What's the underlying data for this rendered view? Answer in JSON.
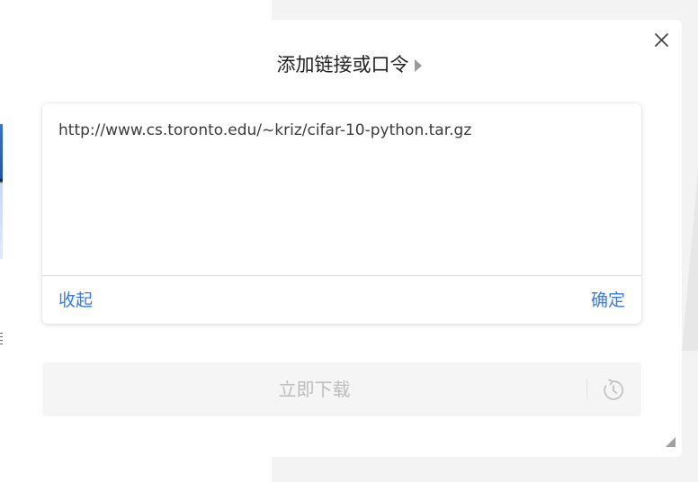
{
  "dialog": {
    "title": "添加链接或口令",
    "title_arrow_icon": "triangle-right-icon",
    "close_icon": "close-icon"
  },
  "link_input": {
    "value": "http://www.cs.toronto.edu/~kriz/cifar-10-python.tar.gz",
    "collapse_label": "收起",
    "confirm_label": "确定"
  },
  "download": {
    "label": "立即下载",
    "schedule_icon": "clock-timer-icon"
  },
  "colors": {
    "accent": "#3b7bd8",
    "disabled_text": "#bdbdbd",
    "title_text": "#222222"
  }
}
